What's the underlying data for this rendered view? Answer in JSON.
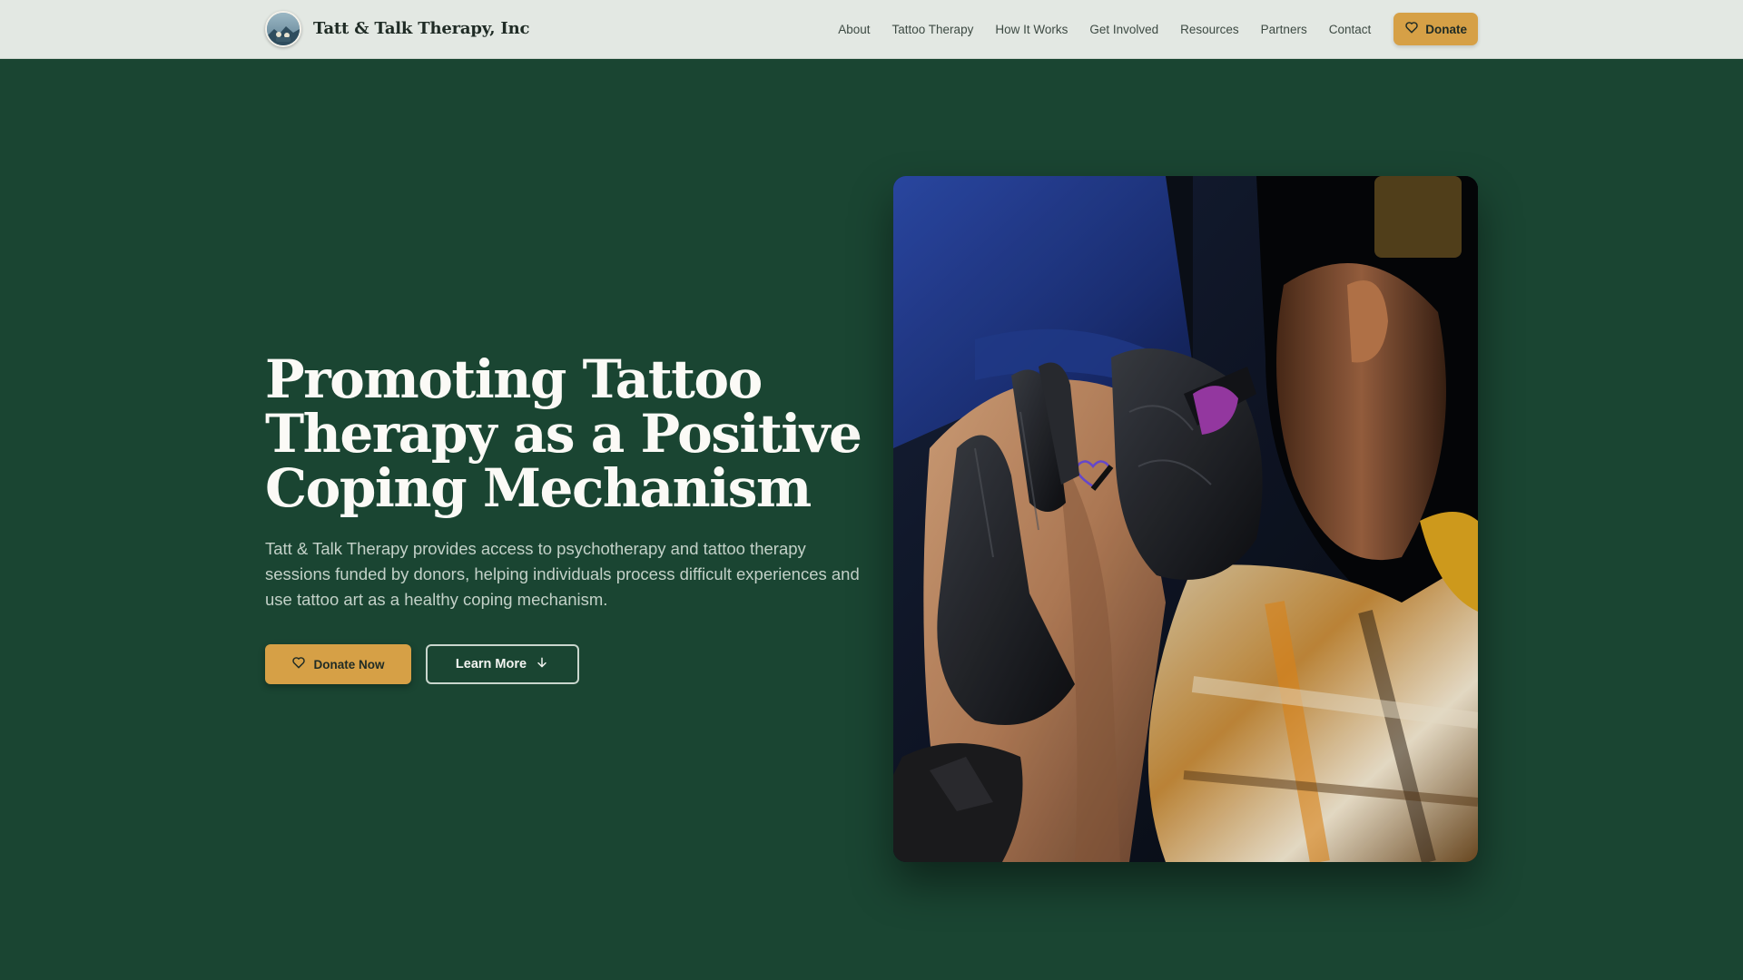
{
  "header": {
    "brand_name": "Tatt & Talk Therapy, Inc",
    "logo_icon": "organization-logo-icon",
    "nav": [
      {
        "label": "About"
      },
      {
        "label": "Tattoo Therapy"
      },
      {
        "label": "How It Works"
      },
      {
        "label": "Get Involved"
      },
      {
        "label": "Resources"
      },
      {
        "label": "Partners"
      },
      {
        "label": "Contact"
      }
    ],
    "donate_label": "Donate",
    "donate_icon": "heart-icon"
  },
  "hero": {
    "title_line1": "Promoting Tattoo",
    "title_line2": "Therapy as a Positive",
    "title_line3": "Coping Mechanism",
    "subtitle": "Tatt & Talk Therapy provides access to psychotherapy and tattoo therapy sessions funded by donors, helping individuals process difficult experiences and use tattoo art as a healthy coping mechanism.",
    "primary_button": {
      "label": "Donate Now",
      "icon": "heart-icon"
    },
    "secondary_button": {
      "label": "Learn More",
      "icon": "arrow-down-icon"
    },
    "image_icon": "tattoo-artist-photo"
  },
  "colors": {
    "background": "#1a4532",
    "header_background": "#e3e8e3",
    "accent": "#d6a046",
    "title_text": "#fbfaf6",
    "subtitle_text": "#c3d1c8"
  }
}
